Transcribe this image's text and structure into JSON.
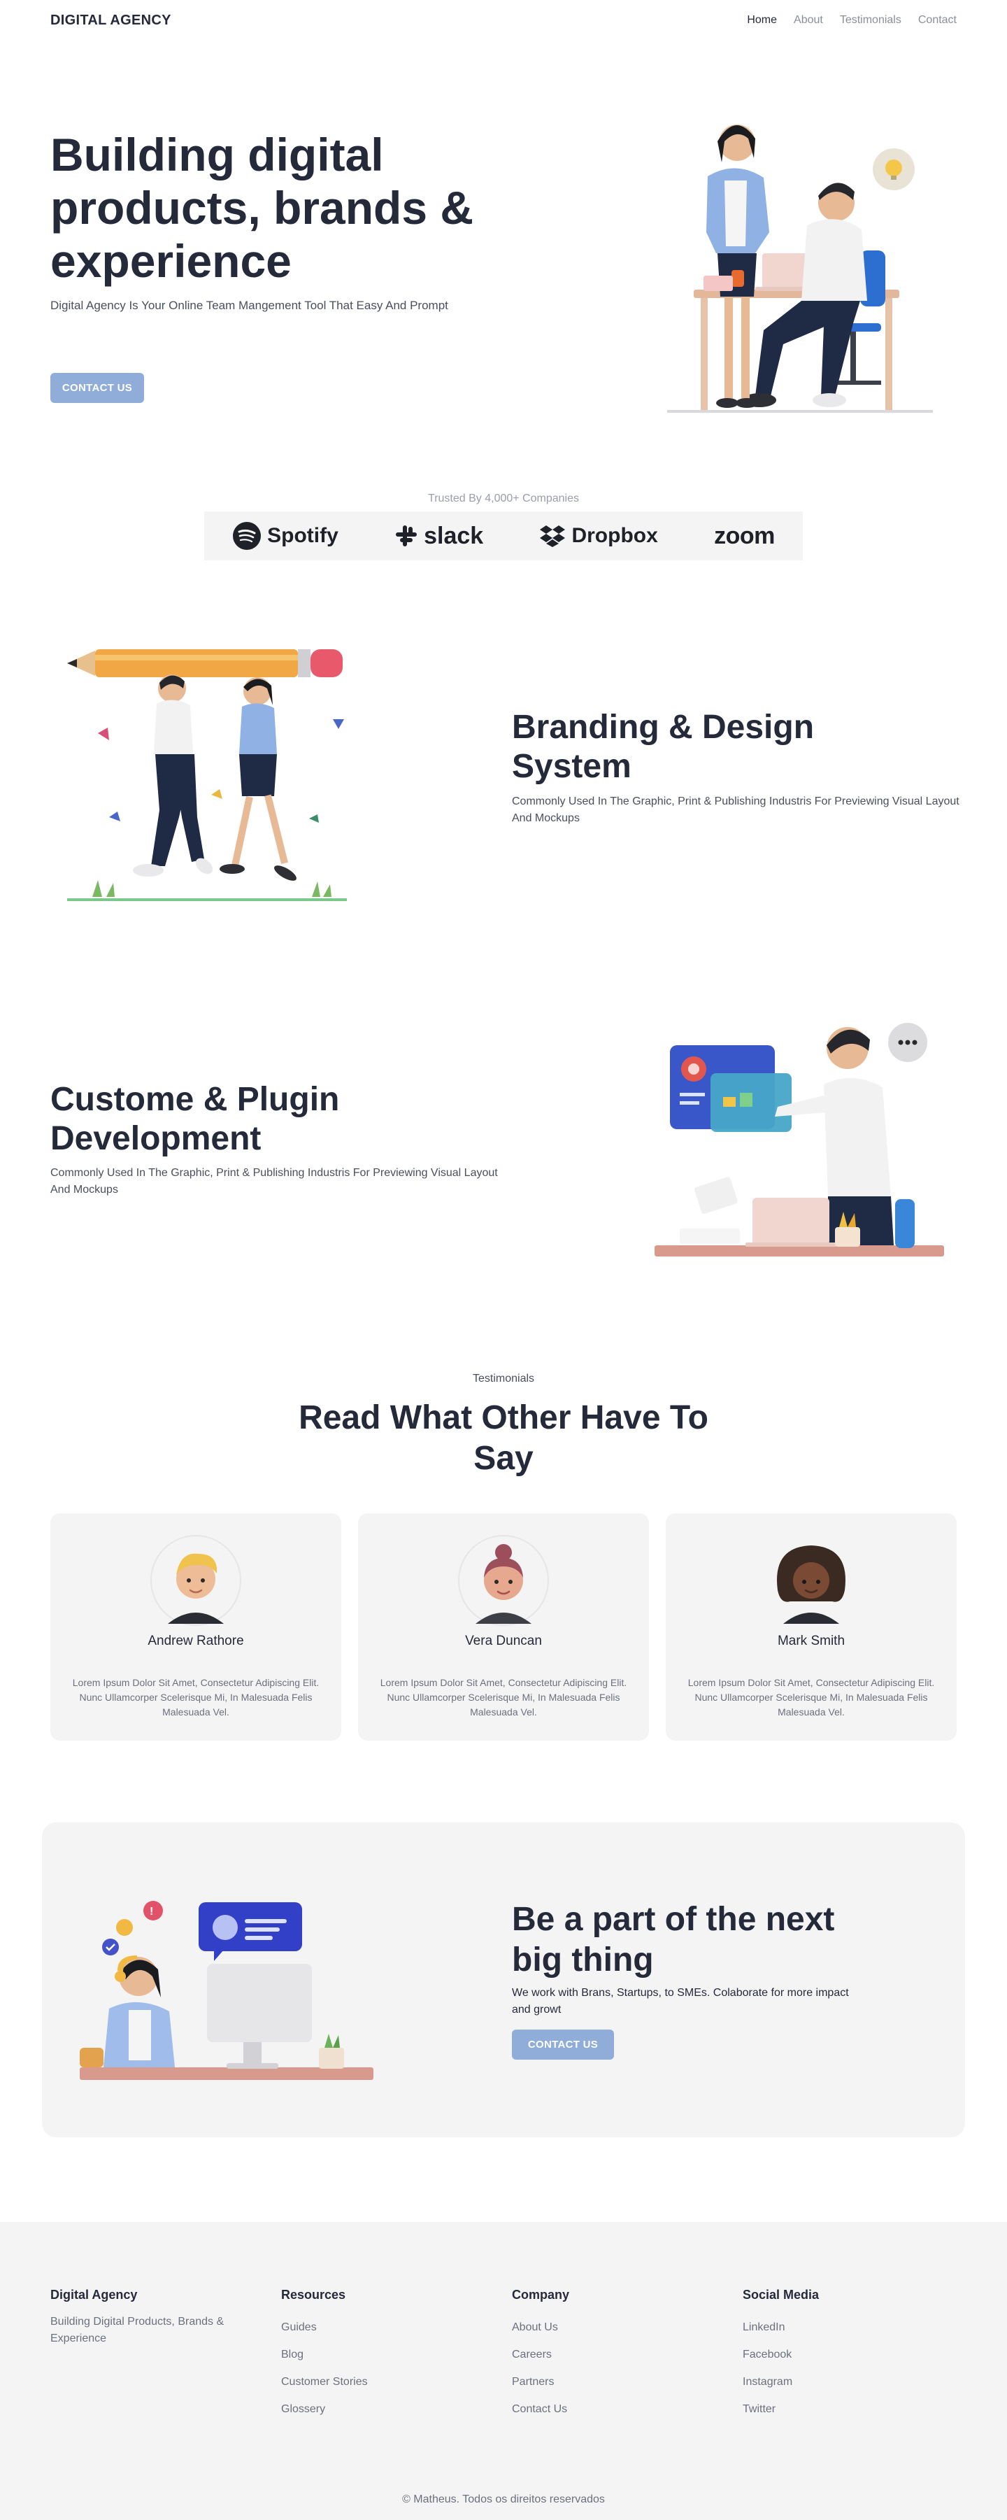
{
  "nav": {
    "logo": "DIGITAL AGENCY",
    "links": [
      "Home",
      "About",
      "Testimonials",
      "Contact"
    ]
  },
  "hero": {
    "title": "Building digital products, brands & experience",
    "subtitle": "Digital Agency Is Your Online Team Mangement Tool That Easy And Prompt",
    "cta_label": "CONTACT US"
  },
  "trusted": {
    "text": "Trusted By 4,000+ Companies",
    "brands": [
      "Spotify",
      "slack",
      "Dropbox",
      "zoom"
    ]
  },
  "features": [
    {
      "title": "Branding & Design System",
      "text": "Commonly Used In The Graphic, Print & Publishing Industris For Previewing Visual Layout And Mockups"
    },
    {
      "title": "Custome & Plugin Development",
      "text": "Commonly Used In The Graphic, Print & Publishing Industris For Previewing Visual Layout And Mockups"
    }
  ],
  "testimonials": {
    "label": "Testimonials",
    "title": "Read What Other Have To Say",
    "cards": [
      {
        "name": "Andrew Rathore",
        "text": "Lorem Ipsum Dolor Sit Amet, Consectetur Adipiscing Elit. Nunc Ullamcorper Scelerisque Mi, In Malesuada Felis Malesuada Vel."
      },
      {
        "name": "Vera Duncan",
        "text": "Lorem Ipsum Dolor Sit Amet, Consectetur Adipiscing Elit. Nunc Ullamcorper Scelerisque Mi, In Malesuada Felis Malesuada Vel."
      },
      {
        "name": "Mark Smith",
        "text": "Lorem Ipsum Dolor Sit Amet, Consectetur Adipiscing Elit. Nunc Ullamcorper Scelerisque Mi, In Malesuada Felis Malesuada Vel."
      }
    ]
  },
  "cta": {
    "title": "Be a part of the next big thing",
    "text": "We work with Brans, Startups, to SMEs. Colaborate for more impact and growt",
    "button_label": "CONTACT US"
  },
  "footer": {
    "brand": {
      "title": "Digital Agency",
      "description": "Building Digital Products, Brands & Experience"
    },
    "resources": {
      "title": "Resources",
      "links": [
        "Guides",
        "Blog",
        "Customer Stories",
        "Glossery"
      ]
    },
    "company": {
      "title": "Company",
      "links": [
        "About Us",
        "Careers",
        "Partners",
        "Contact Us"
      ]
    },
    "social": {
      "title": "Social Media",
      "links": [
        "LinkedIn",
        "Facebook",
        "Instagram",
        "Twitter"
      ]
    },
    "copyright": "© Matheus. Todos os direitos reservados"
  },
  "colors": {
    "primary_text": "#252a3a",
    "button": "#8fadd8",
    "muted": "#6b707d",
    "panel": "#f4f4f5"
  }
}
